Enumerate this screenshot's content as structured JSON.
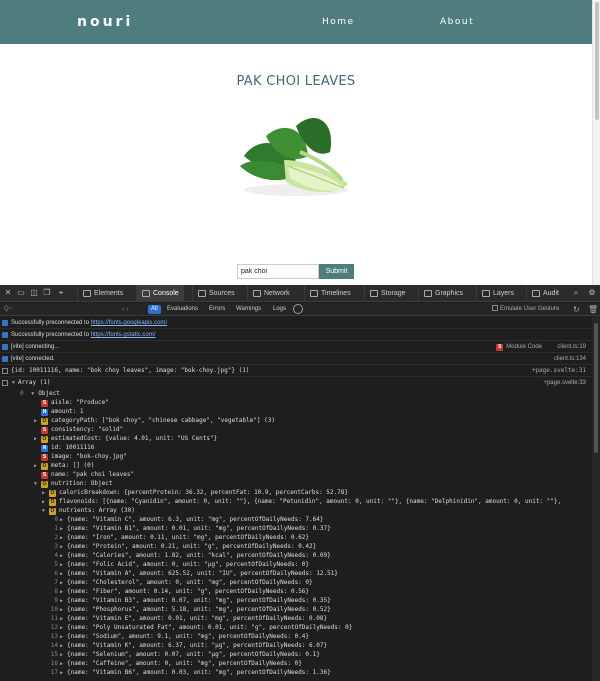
{
  "site": {
    "brand": "nouri",
    "nav": [
      "Home",
      "About"
    ],
    "title": "PAK CHOI LEAVES",
    "search_value": "pak choi",
    "submit_label": "Submit"
  },
  "devtools": {
    "tabs": [
      "Elements",
      "Console",
      "Sources",
      "Network",
      "Timelines",
      "Storage",
      "Graphics",
      "Layers",
      "Audit"
    ],
    "active_tab": "Console",
    "levels": [
      "All",
      "Evaluations",
      "Errors",
      "Warnings",
      "Logs"
    ],
    "emulate_label": "Emulate User Gesture",
    "filter_placeholder": "Q~",
    "logs": [
      {
        "prefix": "Successfully preconnected to ",
        "link": "https://fonts.googleapis.com/"
      },
      {
        "prefix": "Successfully preconnected to ",
        "link": "https://fonts.gstatic.com/"
      },
      {
        "text": "[vite] connecting...",
        "module": "Module Code",
        "src": "client.ts:19"
      },
      {
        "text": "[vite] connected.",
        "src": "client.ts:134"
      },
      {
        "text": "{id: 10011116, name: \"bok choy leaves\", image: \"bok-choy.jpg\"} (1)",
        "src": "+page.svelte:31"
      },
      {
        "text": "Array (1)",
        "src": "+page.svelte:33"
      }
    ],
    "object": {
      "index_label": "0",
      "object_label": "Object",
      "fields": [
        {
          "badge": "S",
          "text": "aisle: \"Produce\""
        },
        {
          "badge": "N",
          "text": "amount: 1"
        },
        {
          "badge": "O",
          "text": "categoryPath: [\"bok choy\", \"chinese cabbage\", \"vegetable\"] (3)"
        },
        {
          "badge": "S",
          "text": "consistency: \"solid\""
        },
        {
          "badge": "O",
          "text": "estimatedCost: {value: 4.01, unit: \"US Cents\"}"
        },
        {
          "badge": "N",
          "text": "id: 10011116"
        },
        {
          "badge": "S",
          "text": "image: \"bok-choy.jpg\""
        },
        {
          "badge": "O",
          "text": "meta: [] (0)"
        },
        {
          "badge": "S",
          "text": "name: \"pak choi leaves\""
        },
        {
          "badge": "O",
          "text": "nutrition: Object"
        }
      ],
      "nutrition_fields": [
        {
          "badge": "O",
          "text": "caloricBreakdown: {percentProtein: 36.32, percentFat: 10.9, percentCarbs: 52.78}"
        },
        {
          "badge": "O",
          "text": "flavonoids: [{name: \"Cyanidin\", amount: 0, unit: \"\"}, {name: \"Petunidin\", amount: 0, unit: \"\"}, {name: \"Delphinidin\", amount: 0, unit: \"\"},"
        },
        {
          "badge": "O",
          "text": "nutrients: Array (30)"
        }
      ],
      "nutrients": [
        "{name: \"Vitamin C\", amount: 6.3, unit: \"mg\", percentOfDailyNeeds: 7.64}",
        "{name: \"Vitamin B1\", amount: 0.01, unit: \"mg\", percentOfDailyNeeds: 0.37}",
        "{name: \"Iron\", amount: 0.11, unit: \"mg\", percentOfDailyNeeds: 0.62}",
        "{name: \"Protein\", amount: 0.21, unit: \"g\", percentOfDailyNeeds: 0.42}",
        "{name: \"Calories\", amount: 1.82, unit: \"kcal\", percentOfDailyNeeds: 0.09}",
        "{name: \"Folic Acid\", amount: 0, unit: \"µg\", percentOfDailyNeeds: 0}",
        "{name: \"Vitamin A\", amount: 625.52, unit: \"IU\", percentOfDailyNeeds: 12.51}",
        "{name: \"Cholesterol\", amount: 0, unit: \"mg\", percentOfDailyNeeds: 0}",
        "{name: \"Fiber\", amount: 0.14, unit: \"g\", percentOfDailyNeeds: 0.56}",
        "{name: \"Vitamin B3\", amount: 0.07, unit: \"mg\", percentOfDailyNeeds: 0.35}",
        "{name: \"Phosphorus\", amount: 5.18, unit: \"mg\", percentOfDailyNeeds: 0.52}",
        "{name: \"Vitamin E\", amount: 0.01, unit: \"mg\", percentOfDailyNeeds: 0.08}",
        "{name: \"Poly Unsaturated Fat\", amount: 0.01, unit: \"g\", percentOfDailyNeeds: 0}",
        "{name: \"Sodium\", amount: 9.1, unit: \"mg\", percentOfDailyNeeds: 0.4}",
        "{name: \"Vitamin K\", amount: 6.37, unit: \"µg\", percentOfDailyNeeds: 6.07}",
        "{name: \"Selenium\", amount: 0.07, unit: \"µg\", percentOfDailyNeeds: 0.1}",
        "{name: \"Caffeine\", amount: 0, unit: \"mg\", percentOfDailyNeeds: 0}",
        "{name: \"Vitamin B6\", amount: 0.03, unit: \"mg\", percentOfDailyNeeds: 1.36}"
      ]
    }
  }
}
